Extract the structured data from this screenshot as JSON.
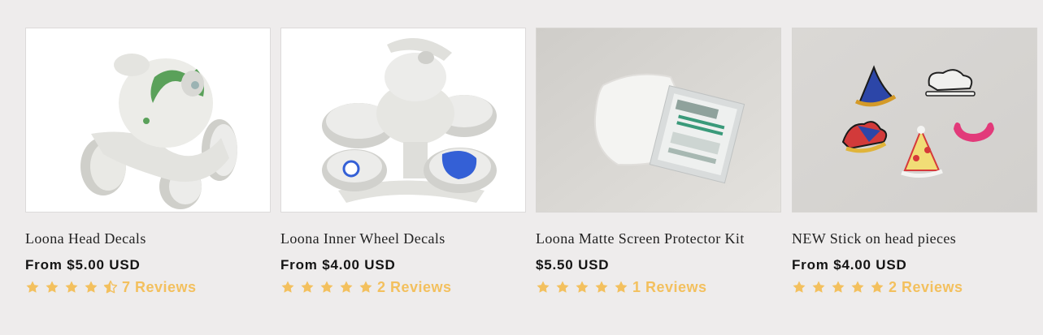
{
  "products": [
    {
      "title": "Loona Head Decals",
      "price": "From $5.00 USD",
      "rating": 4.5,
      "reviews": "7 Reviews",
      "image": "robot-head-decal"
    },
    {
      "title": "Loona Inner Wheel Decals",
      "price": "From $4.00 USD",
      "rating": 5,
      "reviews": "2 Reviews",
      "image": "robot-wheel-decal"
    },
    {
      "title": "Loona Matte Screen Protector Kit",
      "price": "$5.50 USD",
      "rating": 5,
      "reviews": "1 Reviews",
      "image": "screen-protector-photo"
    },
    {
      "title": "NEW Stick on head pieces",
      "price": "From $4.00 USD",
      "rating": 5,
      "reviews": "2 Reviews",
      "image": "head-pieces-photo"
    }
  ],
  "colors": {
    "star": "#f3c05e",
    "background": "#eeecec"
  }
}
